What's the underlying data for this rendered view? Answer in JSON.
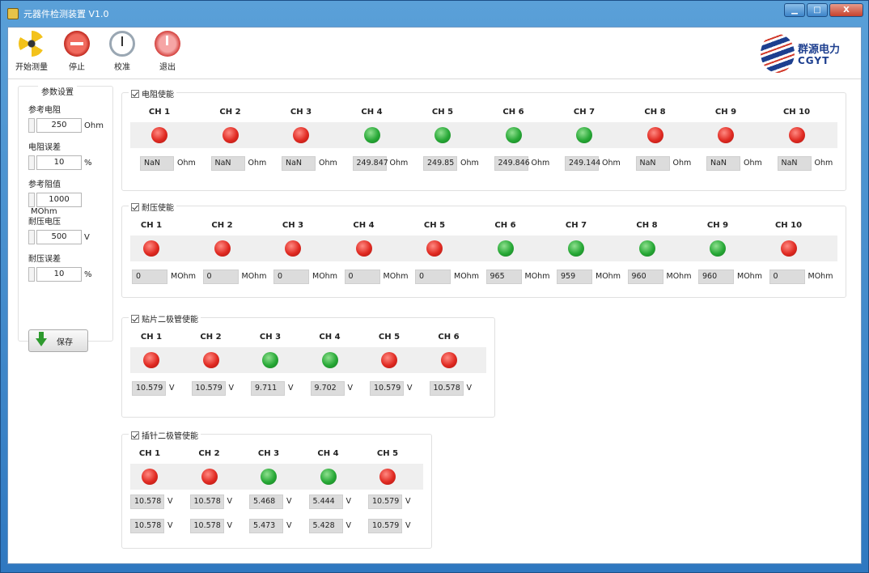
{
  "window": {
    "title": "元器件检测装置 V1.0",
    "buttons": {
      "minimize": "▁",
      "maximize": "□",
      "close": "X"
    }
  },
  "toolbar": {
    "items": [
      {
        "label": "开始测量",
        "icon": "fan-icon"
      },
      {
        "label": "停止",
        "icon": "stop-icon"
      },
      {
        "label": "校准",
        "icon": "clock-icon"
      },
      {
        "label": "退出",
        "icon": "power-icon"
      }
    ]
  },
  "logo": {
    "cn": "群源电力",
    "en": "CGYT"
  },
  "params": {
    "title": "参数设置",
    "fields": [
      {
        "label": "参考电阻",
        "value": "250",
        "unit": "Ohm"
      },
      {
        "label": "电阻误差",
        "value": "10",
        "unit": "%"
      },
      {
        "label": "参考阻值",
        "value": "1000",
        "unit": "MOhm"
      },
      {
        "label": "耐压电压",
        "value": "500",
        "unit": "V"
      },
      {
        "label": "耐压误差",
        "value": "10",
        "unit": "%"
      }
    ],
    "save_label": "保存"
  },
  "groups": {
    "resistance": {
      "title": "电阻使能",
      "unit": "Ohm",
      "channels": [
        {
          "name": "CH 1",
          "status": "red",
          "value": "NaN"
        },
        {
          "name": "CH 2",
          "status": "red",
          "value": "NaN"
        },
        {
          "name": "CH 3",
          "status": "red",
          "value": "NaN"
        },
        {
          "name": "CH 4",
          "status": "green",
          "value": "249.847"
        },
        {
          "name": "CH 5",
          "status": "green",
          "value": "249.85"
        },
        {
          "name": "CH 6",
          "status": "green",
          "value": "249.846"
        },
        {
          "name": "CH 7",
          "status": "green",
          "value": "249.144"
        },
        {
          "name": "CH 8",
          "status": "red",
          "value": "NaN"
        },
        {
          "name": "CH 9",
          "status": "red",
          "value": "NaN"
        },
        {
          "name": "CH 10",
          "status": "red",
          "value": "NaN"
        }
      ]
    },
    "insulation": {
      "title": "耐压使能",
      "unit": "MOhm",
      "channels": [
        {
          "name": "CH 1",
          "status": "red",
          "value": "0"
        },
        {
          "name": "CH 2",
          "status": "red",
          "value": "0"
        },
        {
          "name": "CH 3",
          "status": "red",
          "value": "0"
        },
        {
          "name": "CH 4",
          "status": "red",
          "value": "0"
        },
        {
          "name": "CH 5",
          "status": "red",
          "value": "0"
        },
        {
          "name": "CH 6",
          "status": "green",
          "value": "965"
        },
        {
          "name": "CH 7",
          "status": "green",
          "value": "959"
        },
        {
          "name": "CH 8",
          "status": "green",
          "value": "960"
        },
        {
          "name": "CH 9",
          "status": "green",
          "value": "960"
        },
        {
          "name": "CH 10",
          "status": "red",
          "value": "0"
        }
      ]
    },
    "smd_diode": {
      "title": "贴片二极管使能",
      "unit": "V",
      "channels": [
        {
          "name": "CH 1",
          "status": "red",
          "value": "10.579"
        },
        {
          "name": "CH 2",
          "status": "red",
          "value": "10.579"
        },
        {
          "name": "CH 3",
          "status": "green",
          "value": "9.711"
        },
        {
          "name": "CH 4",
          "status": "green",
          "value": "9.702"
        },
        {
          "name": "CH 5",
          "status": "red",
          "value": "10.579"
        },
        {
          "name": "CH 6",
          "status": "red",
          "value": "10.578"
        }
      ]
    },
    "pin_diode": {
      "title": "插针二极管使能",
      "unit": "V",
      "channels": [
        {
          "name": "CH 1",
          "status": "red",
          "value": "10.578",
          "value2": "10.578"
        },
        {
          "name": "CH 2",
          "status": "red",
          "value": "10.578",
          "value2": "10.578"
        },
        {
          "name": "CH 3",
          "status": "green",
          "value": "5.468",
          "value2": "5.473"
        },
        {
          "name": "CH 4",
          "status": "green",
          "value": "5.444",
          "value2": "5.428"
        },
        {
          "name": "CH 5",
          "status": "red",
          "value": "10.579",
          "value2": "10.579"
        }
      ]
    }
  }
}
